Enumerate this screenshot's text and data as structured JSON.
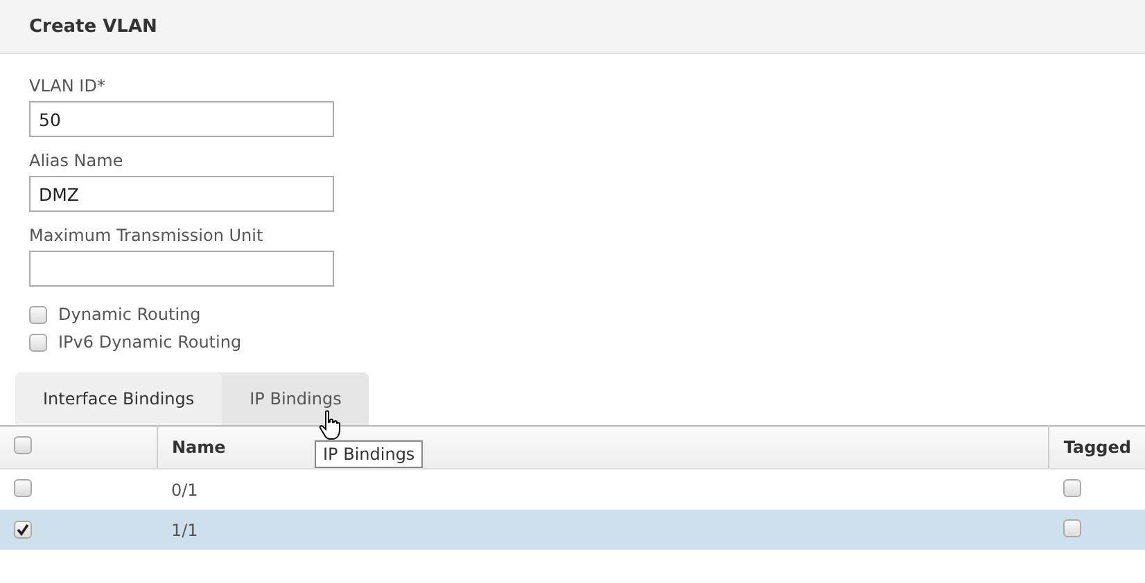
{
  "header": {
    "title": "Create VLAN"
  },
  "fields": [
    {
      "label": "VLAN ID*",
      "value": "50"
    },
    {
      "label": "Alias Name",
      "value": "DMZ"
    },
    {
      "label": "Maximum Transmission Unit"
    }
  ],
  "options": [
    {
      "label": "Dynamic Routing",
      "checked": false
    },
    {
      "label": "IPv6 Dynamic Routing",
      "checked": false
    }
  ],
  "tabs": [
    {
      "label": "Interface Bindings",
      "selected": true
    },
    {
      "label": "IP Bindings",
      "selected": false
    }
  ],
  "tooltip": "IP Bindings",
  "table": {
    "select_all": false,
    "columns": [
      "Name",
      "Tagged"
    ],
    "rows": [
      {
        "selected": false,
        "name": "0/1",
        "tagged": false
      },
      {
        "selected": true,
        "name": "1/1",
        "tagged": false
      }
    ]
  }
}
